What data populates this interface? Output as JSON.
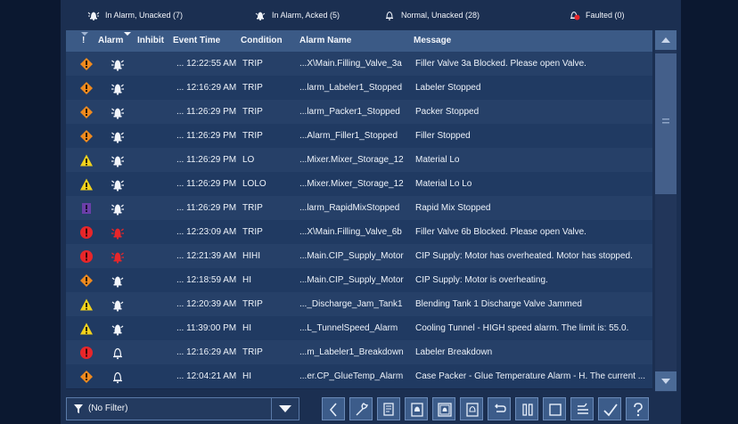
{
  "legend": {
    "unacked": "In Alarm, Unacked (7)",
    "acked": "In Alarm, Acked (5)",
    "normal": "Normal, Unacked (28)",
    "faulted": "Faulted (0)"
  },
  "columns": [
    "!",
    "Alarm",
    "Inhibit",
    "Event Time",
    "Condition",
    "Alarm Name",
    "Message"
  ],
  "rows": [
    {
      "severity": "high",
      "bell": "unacked",
      "time": "... 12:22:55 AM",
      "condition": "TRIP",
      "name": "...X\\Main.Filling_Valve_3a",
      "message": "Filler Valve 3a Blocked. Please open Valve."
    },
    {
      "severity": "high",
      "bell": "unacked",
      "time": "... 12:16:29 AM",
      "condition": "TRIP",
      "name": "...larm_Labeler1_Stopped",
      "message": "Labeler Stopped"
    },
    {
      "severity": "high",
      "bell": "unacked",
      "time": "... 11:26:29 PM",
      "condition": "TRIP",
      "name": "...larm_Packer1_Stopped",
      "message": "Packer Stopped"
    },
    {
      "severity": "high",
      "bell": "unacked",
      "time": "... 11:26:29 PM",
      "condition": "TRIP",
      "name": "...Alarm_Filler1_Stopped",
      "message": "Filler Stopped"
    },
    {
      "severity": "medium",
      "bell": "unacked",
      "time": "... 11:26:29 PM",
      "condition": "LO",
      "name": "...Mixer.Mixer_Storage_12",
      "message": "Material Lo"
    },
    {
      "severity": "medium",
      "bell": "unacked",
      "time": "... 11:26:29 PM",
      "condition": "LOLO",
      "name": "...Mixer.Mixer_Storage_12",
      "message": "Material Lo Lo"
    },
    {
      "severity": "low",
      "bell": "unacked",
      "time": "... 11:26:29 PM",
      "condition": "TRIP",
      "name": "...larm_RapidMixStopped",
      "message": "Rapid Mix Stopped"
    },
    {
      "severity": "urgent",
      "bell": "unacked-red",
      "time": "... 12:23:09 AM",
      "condition": "TRIP",
      "name": "...X\\Main.Filling_Valve_6b",
      "message": "Filler Valve 6b Blocked. Please open Valve."
    },
    {
      "severity": "urgent",
      "bell": "unacked-red",
      "time": "... 12:21:39 AM",
      "condition": "HIHI",
      "name": "...Main.CIP_Supply_Motor",
      "message": "CIP Supply: Motor has overheated. Motor has stopped."
    },
    {
      "severity": "high",
      "bell": "acked",
      "time": "... 12:18:59 AM",
      "condition": "HI",
      "name": "...Main.CIP_Supply_Motor",
      "message": "CIP Supply: Motor is overheating."
    },
    {
      "severity": "medium",
      "bell": "acked",
      "time": "... 12:20:39 AM",
      "condition": "TRIP",
      "name": "..._Discharge_Jam_Tank1",
      "message": "Blending Tank 1 Discharge Valve Jammed"
    },
    {
      "severity": "medium",
      "bell": "acked",
      "time": "... 11:39:00 PM",
      "condition": "HI",
      "name": "...L_TunnelSpeed_Alarm",
      "message": "Cooling Tunnel - HIGH speed alarm. The limit is: 55.0."
    },
    {
      "severity": "urgent",
      "bell": "normal",
      "time": "... 12:16:29 AM",
      "condition": "TRIP",
      "name": "...m_Labeler1_Breakdown",
      "message": "Labeler Breakdown"
    },
    {
      "severity": "high",
      "bell": "normal",
      "time": "... 12:04:21 AM",
      "condition": "HI",
      "name": "...er.CP_GlueTemp_Alarm",
      "message": "Case Packer - Glue Temperature Alarm - H. The current ..."
    }
  ],
  "filter": {
    "label": "(No Filter)"
  },
  "toolbar": [
    "scroll-left",
    "edit-alarm",
    "details",
    "ack-selected",
    "ack-page",
    "ack-all",
    "reset",
    "pause",
    "select-all",
    "shelve",
    "approve",
    "help"
  ],
  "colors": {
    "high": "#f08a1e",
    "medium": "#f2d21c",
    "low": "#6a3fa8",
    "urgent": "#e8262a",
    "bell": "#f2f5fb",
    "bellRed": "#e8262a"
  }
}
